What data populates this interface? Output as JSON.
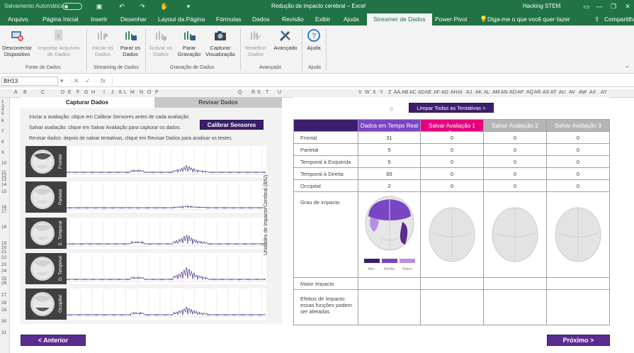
{
  "titlebar": {
    "autosave": "Salvamento Automático",
    "autosave_state": "Desativado",
    "doc_title": "Redução de impacto cerebral – Excel",
    "account": "Hacking STEM"
  },
  "tabs": [
    "Arquivo",
    "Página Inicial",
    "Inserir",
    "Desenhar",
    "Layout da Página",
    "Fórmulas",
    "Dados",
    "Revisão",
    "Exibir",
    "Ajuda",
    "Streamer de Dados",
    "Power Pivot",
    "Diga-me o que você quer fazer",
    "Compartilhar"
  ],
  "ribbon": {
    "buttons": [
      {
        "label1": "Desconectar",
        "label2": "Dispositivo",
        "icon": "disconnect-device-icon",
        "enabled": true
      },
      {
        "label1": "Importar Arquivos",
        "label2": "de Dados",
        "icon": "import-files-icon",
        "enabled": false
      },
      {
        "label1": "Iniciar os",
        "label2": "Dados",
        "icon": "start-data-icon",
        "enabled": false
      },
      {
        "label1": "Parar os",
        "label2": "Dados",
        "icon": "stop-data-icon",
        "enabled": true
      },
      {
        "label1": "Gravar os",
        "label2": "Dados",
        "icon": "record-data-icon",
        "enabled": false
      },
      {
        "label1": "Parar",
        "label2": "Gravação",
        "icon": "stop-record-icon",
        "enabled": true
      },
      {
        "label1": "Capturar",
        "label2": "Visualização",
        "icon": "camera-icon",
        "enabled": true
      },
      {
        "label1": "Redefinir",
        "label2": "Dados",
        "icon": "reset-data-icon",
        "enabled": false
      },
      {
        "label1": "Avançado",
        "label2": "",
        "icon": "advanced-tools-icon",
        "enabled": true
      },
      {
        "label1": "Ajuda",
        "label2": "",
        "icon": "help-icon",
        "enabled": true
      }
    ],
    "groups": [
      "Fonte de Dados",
      "Streaming de Dados",
      "Gravação de Dados",
      "Avançado",
      "Ajuda"
    ]
  },
  "formula": {
    "namebox": "BH13",
    "fx": "fx",
    "content": ""
  },
  "columns": [
    "A",
    "B",
    "C",
    "D",
    "E",
    "F",
    "G",
    "H",
    "I",
    "J",
    "K",
    "L",
    "M",
    "N",
    "O",
    "P",
    "Q",
    "R",
    "S",
    "T",
    "U",
    "V",
    "W",
    "X",
    "Y",
    "Z",
    "AA",
    "AB",
    "AC",
    "AD",
    "AE",
    "AF",
    "AG",
    "AH",
    "AI",
    "AJ",
    "AK",
    "AL",
    "AM",
    "AN",
    "AO",
    "AP",
    "AQ",
    "AR",
    "AS",
    "AT",
    "AU",
    "AV",
    "AW",
    "AX",
    "AY"
  ],
  "rows": [
    "1",
    "3",
    "4",
    "5",
    "6",
    "7",
    "8",
    "9",
    "10",
    "11",
    "12",
    "13",
    "14",
    "15",
    "16",
    "17",
    "18",
    "19",
    "20",
    "21",
    "22",
    "23",
    "24",
    "25",
    "26",
    "27",
    "28",
    "29",
    "30",
    "31"
  ],
  "left": {
    "tab_capture": "Capturar Dados",
    "tab_review": "Revisar Dados",
    "instr1": "Iniciar a avaliação: clique em Calibrar Sensores antes de cada avaliação.",
    "instr2": "Salvar avaliação: clique em Salvar Avaliação para capturar os dados.",
    "instr3": "Revisar dados: depois de salvar tentativas, clique em Revisar Dados para analisar os testes.",
    "calibrate": "Calibrar Sensores",
    "yaxis": "Unidades de Impacto Cerebral (BIU)",
    "plots": [
      "Frontal",
      "Parietal",
      "E. Temporal",
      "D. Temporal",
      "Occipital"
    ]
  },
  "right": {
    "clear": "Limpar Todas as Tentativas >",
    "headers": [
      "Dados em Tempo Real",
      "Salvar Avaliação 1",
      "Salvar Avaliação 2",
      "Salvar Avaliação 3"
    ],
    "rows": [
      {
        "label": "Frontal",
        "values": [
          "31",
          "0",
          "0",
          "0"
        ]
      },
      {
        "label": "Parietal",
        "values": [
          "5",
          "0",
          "0",
          "0"
        ]
      },
      {
        "label": "Temporal à Esquerda",
        "values": [
          "5",
          "0",
          "0",
          "0"
        ]
      },
      {
        "label": "Temporal à Direita",
        "values": [
          "65",
          "0",
          "0",
          "0"
        ]
      },
      {
        "label": "Occipital",
        "values": [
          "2",
          "0",
          "0",
          "0"
        ]
      }
    ],
    "grau": "Grau de impacto",
    "legend": [
      "Alto",
      "Médio",
      "Baixo"
    ],
    "maior": "Maior Impacto",
    "efeitos": "Efeitos de Impacto: essas funções podem ser afetadas"
  },
  "nav": {
    "prev": "< Anterior",
    "next": "Próximo >"
  },
  "colors": {
    "excel_green": "#217346",
    "purple_dark": "#3b1f6e",
    "purple": "#5b2c8f",
    "header_purple": "#7a45c4",
    "pink": "#e6007e",
    "gray_header": "#b5b5b5"
  }
}
